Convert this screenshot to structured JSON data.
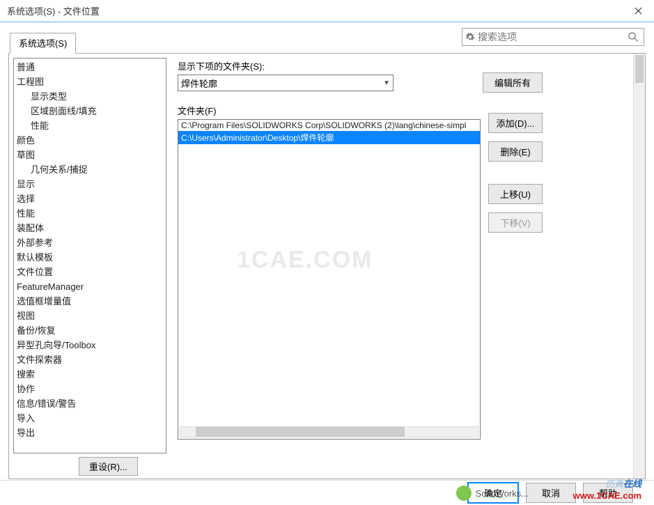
{
  "window": {
    "title": "系统选项(S) - 文件位置"
  },
  "search": {
    "placeholder": "搜索选项"
  },
  "tabs": {
    "system_options": "系统选项(S)"
  },
  "sidebar": {
    "items": [
      {
        "label": "普通",
        "sub": false
      },
      {
        "label": "工程图",
        "sub": false
      },
      {
        "label": "显示类型",
        "sub": true
      },
      {
        "label": "区域剖面线/填充",
        "sub": true
      },
      {
        "label": "性能",
        "sub": true
      },
      {
        "label": "颜色",
        "sub": false
      },
      {
        "label": "草图",
        "sub": false
      },
      {
        "label": "几何关系/捕捉",
        "sub": true
      },
      {
        "label": "显示",
        "sub": false
      },
      {
        "label": "选择",
        "sub": false
      },
      {
        "label": "性能",
        "sub": false
      },
      {
        "label": "装配体",
        "sub": false
      },
      {
        "label": "外部参考",
        "sub": false
      },
      {
        "label": "默认模板",
        "sub": false
      },
      {
        "label": "文件位置",
        "sub": false
      },
      {
        "label": "FeatureManager",
        "sub": false
      },
      {
        "label": "选值框增量值",
        "sub": false
      },
      {
        "label": "视图",
        "sub": false
      },
      {
        "label": "备份/恢复",
        "sub": false
      },
      {
        "label": "异型孔向导/Toolbox",
        "sub": false
      },
      {
        "label": "文件探索器",
        "sub": false
      },
      {
        "label": "搜索",
        "sub": false
      },
      {
        "label": "协作",
        "sub": false
      },
      {
        "label": "信息/错误/警告",
        "sub": false
      },
      {
        "label": "导入",
        "sub": false
      },
      {
        "label": "导出",
        "sub": false
      }
    ],
    "reset": "重设(R)..."
  },
  "content": {
    "show_folder_label": "显示下项的文件夹(S):",
    "combo_value": "焊件轮廓",
    "edit_all": "编辑所有",
    "folder_label": "文件夹(F)",
    "folder_rows": [
      {
        "path": "C:\\Program Files\\SOLIDWORKS Corp\\SOLIDWORKS (2)\\lang\\chinese-simpl",
        "selected": false
      },
      {
        "path": "C:\\Users\\Administrator\\Desktop\\焊件轮廓",
        "selected": true
      }
    ],
    "buttons": {
      "add": "添加(D)...",
      "delete": "删除(E)",
      "moveup": "上移(U)",
      "movedown": "下移(V)"
    }
  },
  "footer": {
    "ok": "确定",
    "cancel": "取消",
    "help": "帮助"
  },
  "watermark": {
    "center": "1CAE.COM",
    "line1a": "仿真",
    "line1b": "在线",
    "url": "www.1CAE.com",
    "wechat": "SolidWorks..."
  }
}
